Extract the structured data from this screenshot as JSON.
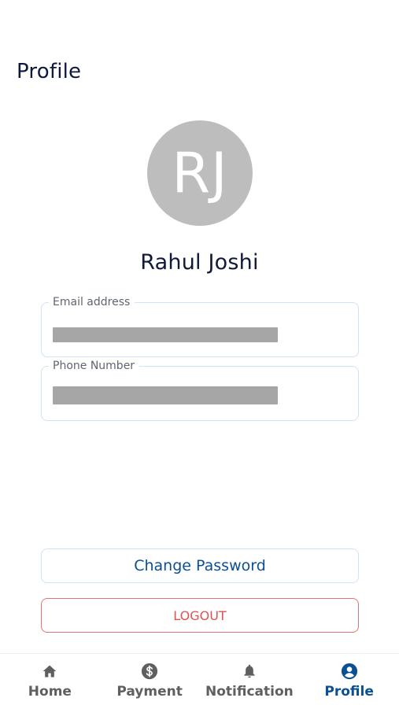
{
  "header": {
    "title": "Profile"
  },
  "profile": {
    "avatar_initials": "RJ",
    "name": "Rahul Joshi"
  },
  "fields": {
    "email_label": "Email address",
    "phone_label": "Phone Number"
  },
  "actions": {
    "change_password_label": "Change Password",
    "logout_label": "LOGOUT"
  },
  "bottom_nav": {
    "items": [
      {
        "label": "Home",
        "icon": "home-icon",
        "active": false
      },
      {
        "label": "Payment",
        "icon": "dollar-circle-icon",
        "active": false
      },
      {
        "label": "Notification",
        "icon": "bell-icon",
        "active": false
      },
      {
        "label": "Profile",
        "icon": "user-circle-icon",
        "active": true
      }
    ]
  },
  "colors": {
    "primary": "#0b4f94",
    "danger": "#e05252",
    "avatar_bg": "#bdbdbd",
    "field_border": "#cfe3fb"
  }
}
